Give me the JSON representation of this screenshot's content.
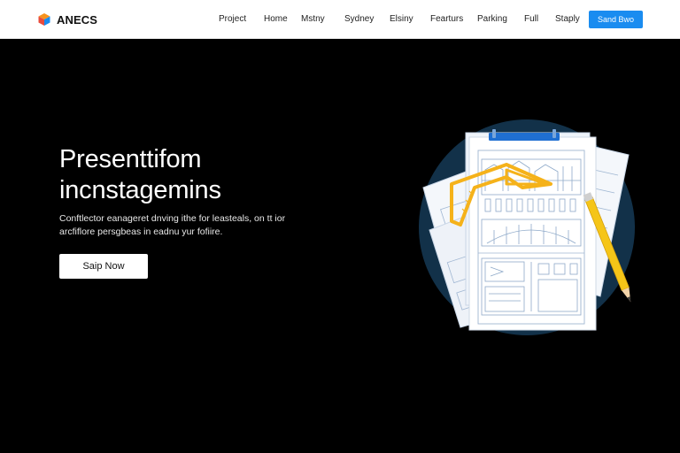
{
  "brand": {
    "name": "ANECS",
    "logo_icon": "cube-logo-icon",
    "logo_colors": [
      "#f7931e",
      "#1a8cf0",
      "#e94b3c"
    ]
  },
  "nav": {
    "items": [
      {
        "label": "Project"
      },
      {
        "label": "Home"
      },
      {
        "label": "Mstny"
      },
      {
        "label": "Sydney"
      },
      {
        "label": "Elsiny"
      },
      {
        "label": "Fearturs"
      },
      {
        "label": "Parking"
      },
      {
        "label": "Full"
      },
      {
        "label": "Staply"
      }
    ],
    "cta_label": "Sand Bwo",
    "cta_color": "#1a8cf0"
  },
  "hero": {
    "title_lines": [
      "Presenttifom",
      "incnstagemins"
    ],
    "subtitle_lines": [
      "Conftlector eanageret dnving ithe for leasteals, on tt ior",
      "arcfiflore persgbeas in eadnu yur fofiire."
    ],
    "button_label": "Saip Now"
  },
  "illustration": {
    "icons": [
      "blueprint-document-icon",
      "ruler-triangle-icon",
      "pencil-icon"
    ],
    "circle_color": "#123149",
    "accent_color": "#f5b21a",
    "clip_color": "#1f6fd1"
  }
}
